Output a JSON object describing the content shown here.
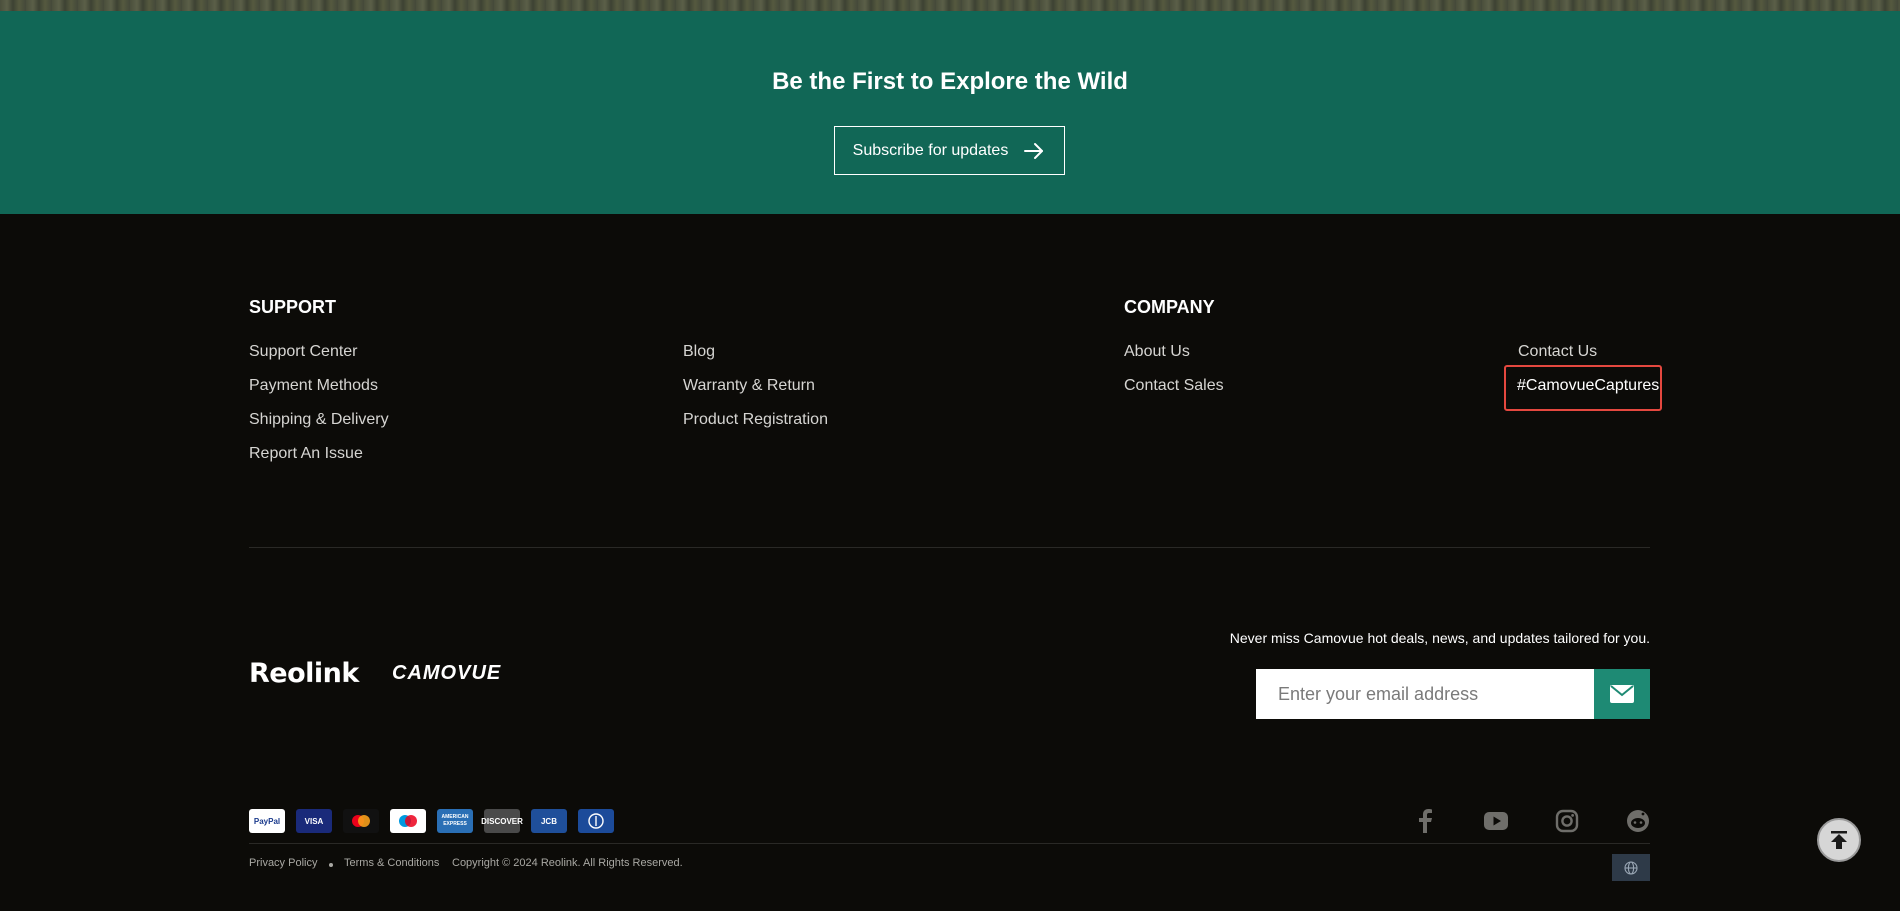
{
  "banner": {
    "title": "Be the First to Explore the Wild",
    "subscribe_label": "Subscribe for updates"
  },
  "support": {
    "heading": "SUPPORT",
    "col1": [
      "Support Center",
      "Payment Methods",
      "Shipping & Delivery",
      "Report An Issue"
    ],
    "col2": [
      "Blog",
      "Warranty & Return",
      "Product Registration"
    ]
  },
  "company": {
    "heading": "COMPANY",
    "col1": [
      "About Us",
      "Contact Sales"
    ],
    "col2": [
      "Contact Us",
      "#CamovueCaptures"
    ]
  },
  "brands": {
    "reolink": "Reolink",
    "camovue": "CAMOVUE"
  },
  "newsletter": {
    "text": "Never miss Camovue hot deals, news, and updates tailored for you.",
    "placeholder": "Enter your email address"
  },
  "payments": [
    {
      "name": "PayPal",
      "label": "PayPal",
      "bg": "#ffffff",
      "fg": "#1a3a8c"
    },
    {
      "name": "Visa",
      "label": "VISA",
      "bg": "#1a2a7a",
      "fg": "#ffffff"
    },
    {
      "name": "Mastercard",
      "label": "",
      "bg": "#111111",
      "fg": "#ffffff"
    },
    {
      "name": "Maestro",
      "label": "",
      "bg": "#ffffff",
      "fg": "#000000"
    },
    {
      "name": "American Express",
      "label": "AMERICAN EXPRESS",
      "bg": "#2a6fb5",
      "fg": "#ffffff"
    },
    {
      "name": "Discover",
      "label": "DISCOVER",
      "bg": "#4a4a4a",
      "fg": "#ffffff"
    },
    {
      "name": "JCB",
      "label": "JCB",
      "bg": "#1f4f9a",
      "fg": "#ffffff"
    },
    {
      "name": "Diners Club",
      "label": "",
      "bg": "#1c4b9a",
      "fg": "#ffffff"
    }
  ],
  "social": [
    "facebook-icon",
    "youtube-icon",
    "instagram-icon",
    "reddit-icon"
  ],
  "legal": {
    "privacy": "Privacy Policy",
    "terms": "Terms & Conditions",
    "copyright": "Copyright © 2024 Reolink. All Rights Reserved."
  },
  "colors": {
    "banner": "#116756",
    "footer": "#0c0b08",
    "accent": "#1e8a74",
    "highlight": "#e5483f"
  }
}
